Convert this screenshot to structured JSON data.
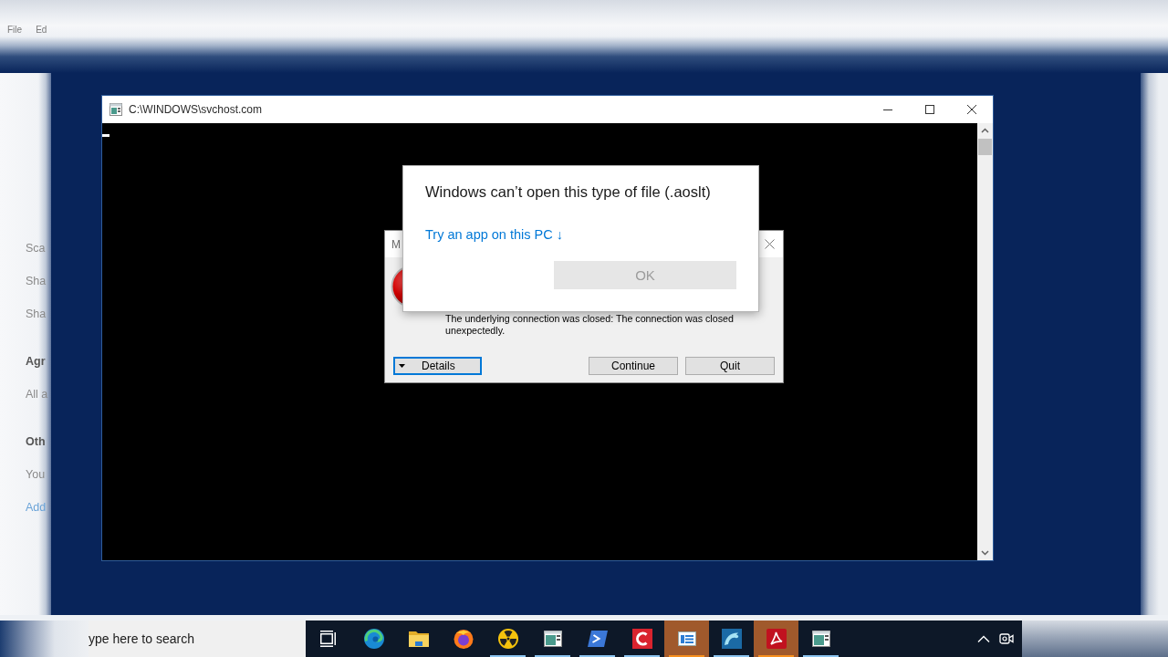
{
  "background_window": {
    "menu": [
      "File",
      "Ed"
    ],
    "sidebar": [
      {
        "kind": "item",
        "label": "Sca"
      },
      {
        "kind": "item",
        "label": "Sha"
      },
      {
        "kind": "item",
        "label": "Sha"
      },
      {
        "kind": "heading",
        "label": "Agr"
      },
      {
        "kind": "item",
        "label": "All a"
      },
      {
        "kind": "heading",
        "label": "Oth"
      },
      {
        "kind": "item",
        "label": "You"
      },
      {
        "kind": "link",
        "label": "Add"
      }
    ]
  },
  "console_window": {
    "title": "C:\\WINDOWS\\svchost.com"
  },
  "error_dialog": {
    "title": "M",
    "message": "The underlying connection was closed: The connection was closed unexpectedly.",
    "buttons": [
      {
        "kind": "expander",
        "label": "Details",
        "focused": true
      },
      {
        "kind": "plain",
        "label": "Continue",
        "focused": false
      },
      {
        "kind": "plain",
        "label": "Quit",
        "focused": false
      }
    ]
  },
  "open_with_dialog": {
    "title": "Windows can’t open this type of file (.aoslt)",
    "link": "Try an app on this PC ↓",
    "button": {
      "label": "OK",
      "disabled": true
    }
  },
  "taskbar": {
    "search": {
      "placeholder": "ype here to search"
    },
    "apps": [
      {
        "kind": "swirl",
        "running": false,
        "flashing": false
      },
      {
        "kind": "folder",
        "running": false,
        "flashing": false
      },
      {
        "kind": "fox",
        "running": false,
        "flashing": false
      },
      {
        "kind": "hazard",
        "running": true,
        "flashing": false
      },
      {
        "kind": "window",
        "running": true,
        "flashing": false
      },
      {
        "kind": "prompt",
        "running": true,
        "flashing": false
      },
      {
        "kind": "arc",
        "running": true,
        "flashing": false
      },
      {
        "kind": "panel",
        "running": true,
        "flashing": true
      },
      {
        "kind": "dolphin",
        "running": true,
        "flashing": false
      },
      {
        "kind": "ribbon",
        "running": true,
        "flashing": true
      },
      {
        "kind": "window",
        "running": true,
        "flashing": false
      }
    ]
  }
}
